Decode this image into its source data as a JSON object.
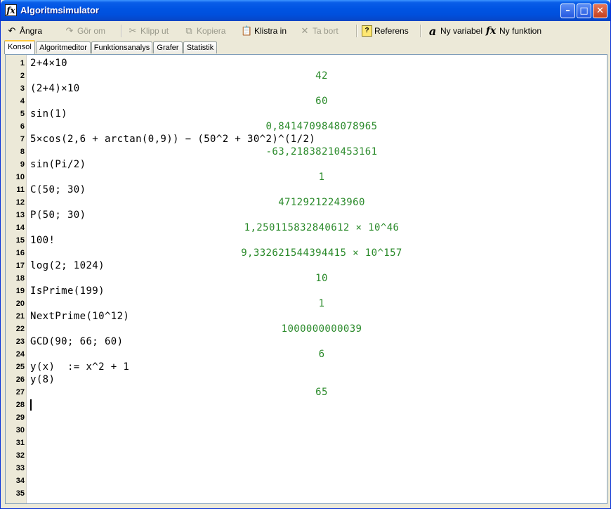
{
  "window": {
    "title": "Algoritmsimulator",
    "app_icon": "fx",
    "min": "–",
    "max": "□",
    "close": "✕"
  },
  "toolbar": {
    "undo": {
      "label": "Ångra",
      "icon": "undo-icon"
    },
    "redo": {
      "label": "Gör om",
      "icon": "redo-icon"
    },
    "cut": {
      "label": "Klipp ut",
      "icon": "scissors-icon"
    },
    "copy": {
      "label": "Kopiera",
      "icon": "copy-icon"
    },
    "paste": {
      "label": "Klistra in",
      "icon": "clipboard-icon"
    },
    "delete": {
      "label": "Ta bort",
      "icon": "x-icon"
    },
    "reference": {
      "label": "Referens",
      "icon": "help-icon"
    },
    "new_variable": {
      "label": "Ny variabel",
      "icon": "variable-icon"
    },
    "new_function": {
      "label": "Ny funktion",
      "icon": "function-icon"
    }
  },
  "tabs": [
    "Konsol",
    "Algoritmeditor",
    "Funktionsanalys",
    "Grafer",
    "Statistik"
  ],
  "console": {
    "lines": [
      {
        "n": "1",
        "type": "input",
        "text": "2+4×10"
      },
      {
        "n": "2",
        "type": "result",
        "text": "42"
      },
      {
        "n": "3",
        "type": "input",
        "text": "(2+4)×10"
      },
      {
        "n": "4",
        "type": "result",
        "text": "60"
      },
      {
        "n": "5",
        "type": "input",
        "text": "sin(1)"
      },
      {
        "n": "6",
        "type": "result",
        "text": "0,8414709848078965"
      },
      {
        "n": "7",
        "type": "input",
        "text": "5×cos(2,6 + arctan(0,9)) − (50^2 + 30^2)^(1/2)"
      },
      {
        "n": "8",
        "type": "result",
        "text": "-63,21838210453161"
      },
      {
        "n": "9",
        "type": "input",
        "text": "sin(Pi/2)"
      },
      {
        "n": "10",
        "type": "result",
        "text": "1"
      },
      {
        "n": "11",
        "type": "input",
        "text": "C(50; 30)"
      },
      {
        "n": "12",
        "type": "result",
        "text": "47129212243960"
      },
      {
        "n": "13",
        "type": "input",
        "text": "P(50; 30)"
      },
      {
        "n": "14",
        "type": "result",
        "text": "1,250115832840612 × 10^46"
      },
      {
        "n": "15",
        "type": "input",
        "text": "100!"
      },
      {
        "n": "16",
        "type": "result",
        "text": "9,332621544394415 × 10^157"
      },
      {
        "n": "17",
        "type": "input",
        "text": "log(2; 1024)"
      },
      {
        "n": "18",
        "type": "result",
        "text": "10"
      },
      {
        "n": "19",
        "type": "input",
        "text": "IsPrime(199)"
      },
      {
        "n": "20",
        "type": "result",
        "text": "1"
      },
      {
        "n": "21",
        "type": "input",
        "text": "NextPrime(10^12)"
      },
      {
        "n": "22",
        "type": "result",
        "text": "1000000000039"
      },
      {
        "n": "23",
        "type": "input",
        "text": "GCD(90; 66; 60)"
      },
      {
        "n": "24",
        "type": "result",
        "text": "6"
      },
      {
        "n": "25",
        "type": "input",
        "text": "y(x)  := x^2 + 1"
      },
      {
        "n": "26",
        "type": "input",
        "text": "y(8)"
      },
      {
        "n": "27",
        "type": "result",
        "text": "65"
      },
      {
        "n": "28",
        "type": "cursor",
        "text": ""
      },
      {
        "n": "29",
        "type": "empty",
        "text": ""
      },
      {
        "n": "30",
        "type": "empty",
        "text": ""
      },
      {
        "n": "31",
        "type": "empty",
        "text": ""
      },
      {
        "n": "32",
        "type": "empty",
        "text": ""
      },
      {
        "n": "33",
        "type": "empty",
        "text": ""
      },
      {
        "n": "34",
        "type": "empty",
        "text": ""
      },
      {
        "n": "35",
        "type": "empty",
        "text": ""
      }
    ]
  }
}
